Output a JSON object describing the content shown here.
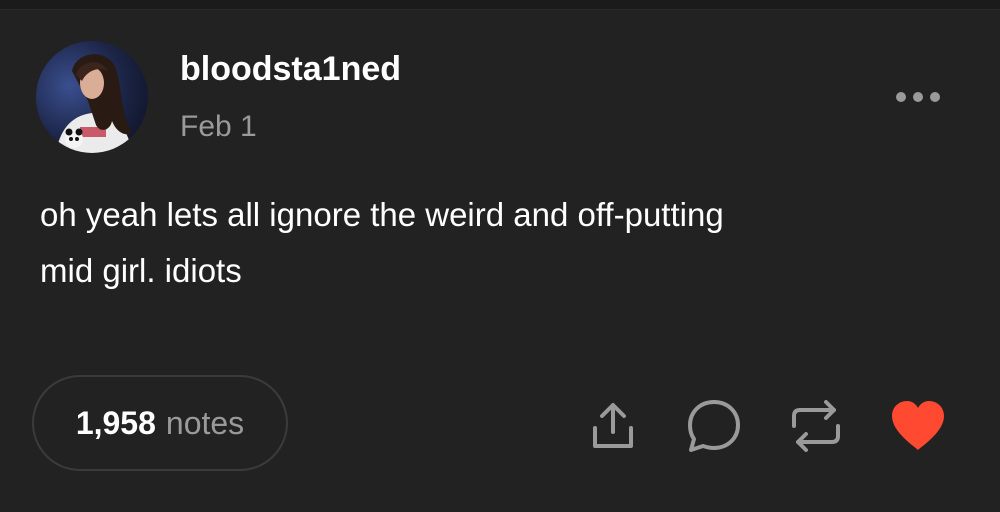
{
  "post": {
    "author": {
      "username": "bloodsta1ned",
      "avatar_icon": "profile-photo"
    },
    "date": "Feb 1",
    "body_lines": [
      "oh yeah lets all ignore the weird and off-putting",
      "mid girl. idiots"
    ],
    "notes": {
      "count": "1,958",
      "label": "notes"
    },
    "actions": [
      {
        "name": "share",
        "icon": "share-icon"
      },
      {
        "name": "reply",
        "icon": "reply-icon"
      },
      {
        "name": "reblog",
        "icon": "reblog-icon"
      },
      {
        "name": "like",
        "icon": "heart-icon"
      }
    ]
  },
  "colors": {
    "background": "#222222",
    "text": "#ffffff",
    "muted_text": "#9a9a9a",
    "like_red": "#ff4930"
  }
}
